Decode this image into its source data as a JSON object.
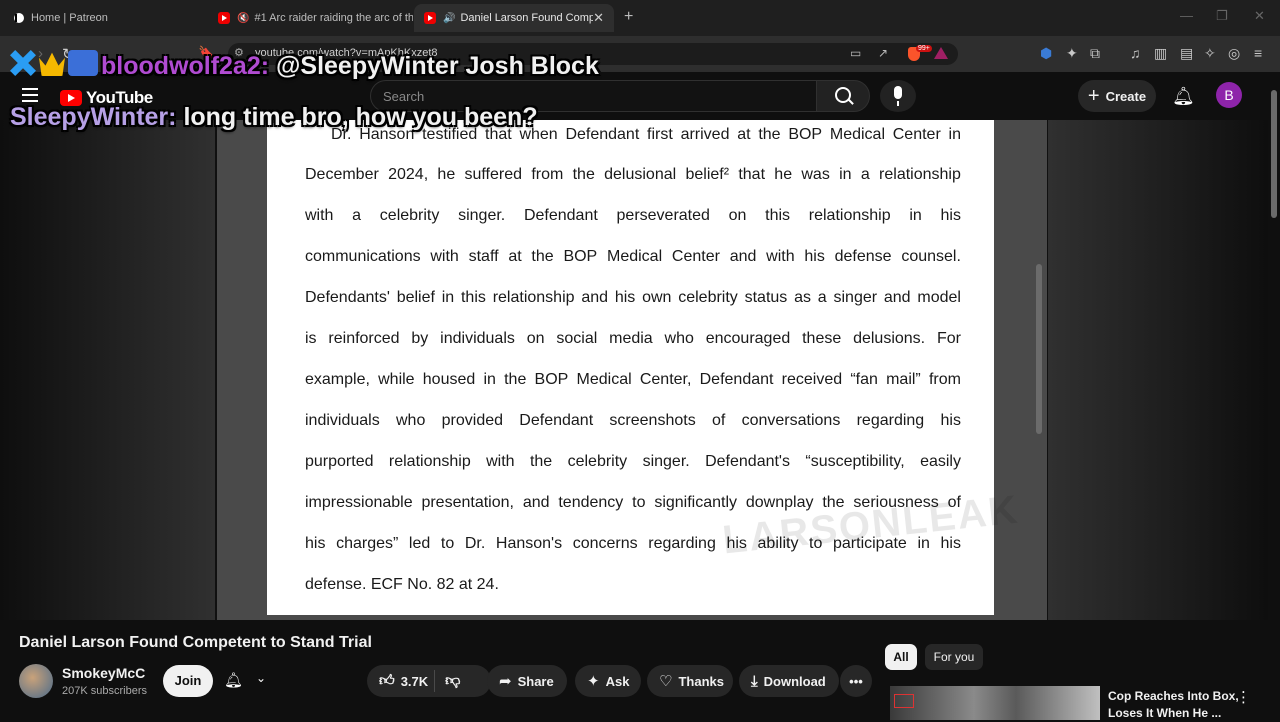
{
  "browser": {
    "tabs": [
      {
        "label": "Home | Patreon",
        "icon": "patreon-icon"
      },
      {
        "label": "#1 Arc raider raiding the arc of th",
        "icon": "youtube-icon",
        "muted": true
      },
      {
        "label": "Daniel Larson Found Compet",
        "icon": "youtube-icon",
        "audio": true,
        "active": true
      }
    ],
    "url": "youtube.com/watch?v=mApKhKxzet8"
  },
  "youtube": {
    "logo": "YouTube",
    "search_placeholder": "Search",
    "create_label": "Create",
    "avatar_letter": "B"
  },
  "chat": {
    "line1_user": "bloodwolf2a2:",
    "line1_text": "@SleepyWinter Josh Block",
    "line1_user_color": "#b04bd1",
    "line2_user": "SleepyWinter:",
    "line2_text": "long time bro, how you been?",
    "line2_user_color": "#b6a0e6"
  },
  "document": {
    "lines": [
      [
        "Dr.",
        "Hanson",
        "testified",
        "that",
        "when",
        "Defendant",
        "first",
        "arrived",
        "at",
        "the",
        "BOP",
        "Medical",
        "Center",
        "in"
      ],
      [
        "December",
        "2024,",
        "he",
        "suffered",
        "from",
        "the",
        "delusional",
        "belief²",
        "that",
        "he",
        "was",
        "in",
        "a",
        "relationship"
      ],
      [
        "with",
        "a",
        "celebrity",
        "singer.",
        "Defendant",
        "perseverated",
        "on",
        "this",
        "relationship",
        "in",
        "his"
      ],
      [
        "communications",
        "with",
        "staff",
        "at",
        "the",
        "BOP",
        "Medical",
        "Center",
        "and",
        "with",
        "his",
        "defense",
        "counsel."
      ],
      [
        "Defendants'",
        "belief",
        "in",
        "this",
        "relationship",
        "and",
        "his",
        "own",
        "celebrity",
        "status",
        "as",
        "a",
        "singer",
        "and",
        "model"
      ],
      [
        "is",
        "reinforced",
        "by",
        "individuals",
        "on",
        "social",
        "media",
        "who",
        "encouraged",
        "these",
        "delusions.",
        "For"
      ],
      [
        "example,",
        "while",
        "housed",
        "in",
        "the",
        "BOP",
        "Medical",
        "Center,",
        "Defendant",
        "received",
        "“fan",
        "mail”",
        "from"
      ],
      [
        "individuals",
        "who",
        "provided",
        "Defendant",
        "screenshots",
        "of",
        "conversations",
        "regarding",
        "his"
      ],
      [
        "purported",
        "relationship",
        "with",
        "the",
        "celebrity",
        "singer.",
        "Defendant's",
        "“susceptibility,",
        "easily"
      ],
      [
        "impressionable",
        "presentation,",
        "and",
        "tendency",
        "to",
        "significantly",
        "downplay",
        "the",
        "seriousness",
        "of"
      ],
      [
        "his",
        "charges”",
        "led",
        "to",
        "Dr.",
        "Hanson's",
        "concerns",
        "regarding",
        "his",
        "ability",
        "to",
        "participate",
        "in",
        "his"
      ]
    ],
    "last_line": "defense. ECF No. 82 at 24.",
    "watermark": "LARSONLEAK"
  },
  "video": {
    "title": "Daniel Larson Found Competent to Stand Trial",
    "channel": "SmokeyMcC",
    "subscribers": "207K subscribers",
    "join_label": "Join",
    "likes": "3.7K",
    "share_label": "Share",
    "ask_label": "Ask",
    "thanks_label": "Thanks",
    "download_label": "Download"
  },
  "recommendations": {
    "chips": [
      "All",
      "For you"
    ],
    "item_title_line1": "Cop Reaches Into Box,",
    "item_title_line2": "Loses It When He ..."
  }
}
